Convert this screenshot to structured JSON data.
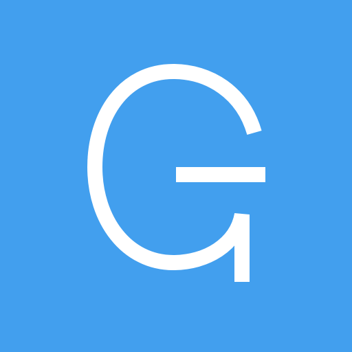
{
  "icon": {
    "logo_letter": "G",
    "background_color": "#429FEE",
    "glyph_color": "#FFFFFF",
    "icon_name": "letter-g-logo-icon"
  }
}
